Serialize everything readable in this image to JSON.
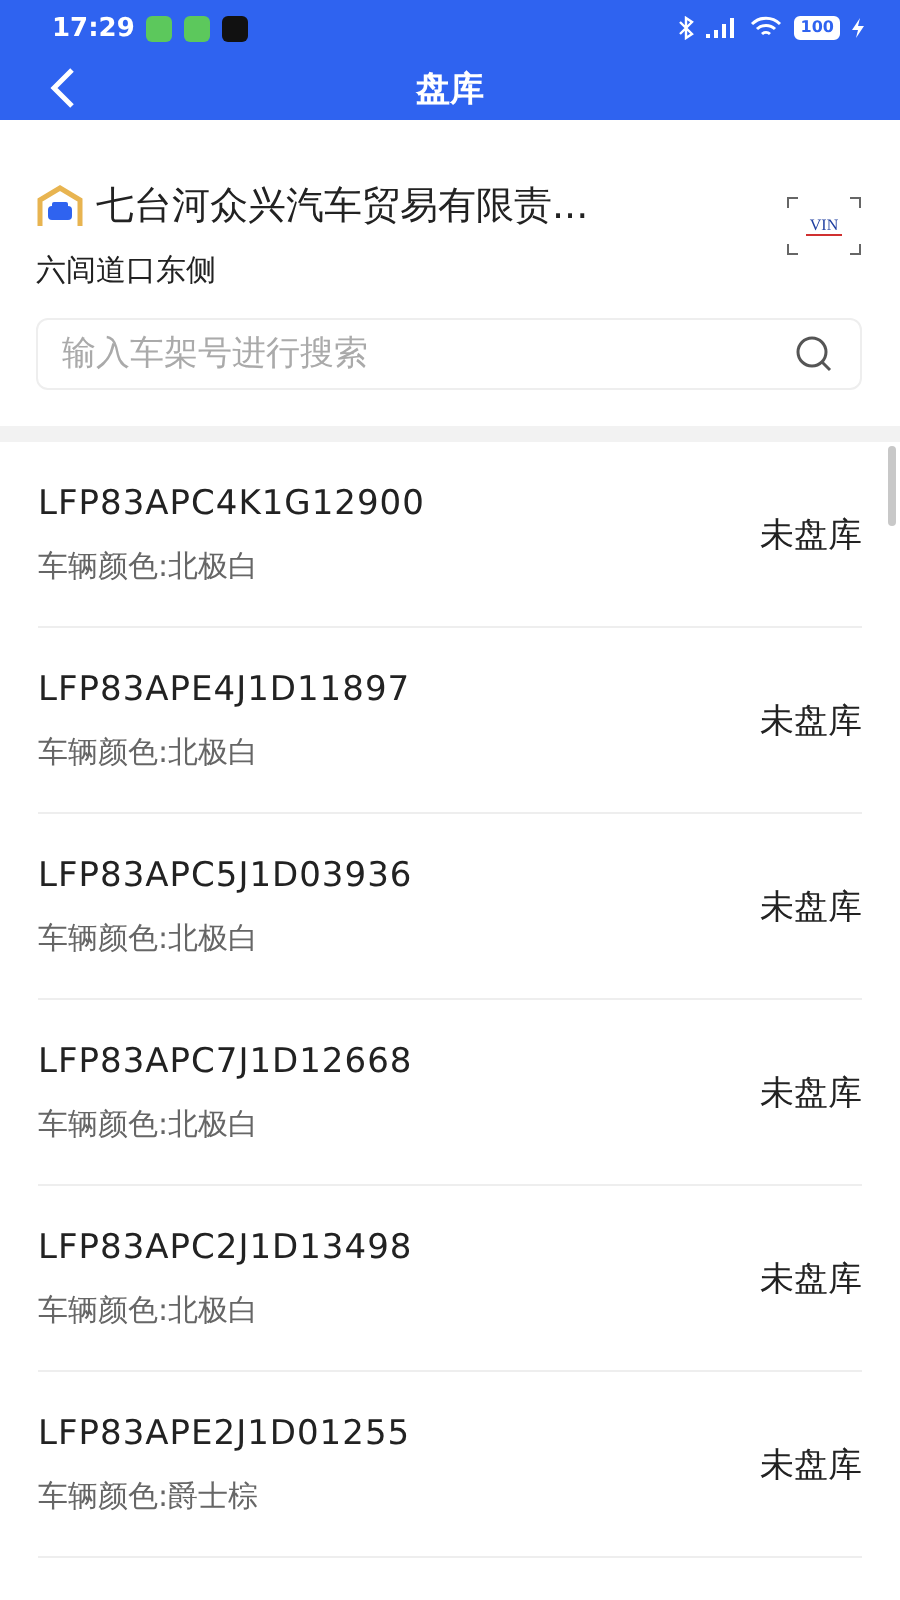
{
  "status_bar": {
    "time": "17:29",
    "battery": "100"
  },
  "header": {
    "title": "盘库"
  },
  "store": {
    "name": "七台河众兴汽车贸易有限责...",
    "location": "六闾道口东侧",
    "vin_label": "VIN"
  },
  "search": {
    "placeholder": "输入车架号进行搜索"
  },
  "vehicles": [
    {
      "vin": "LFP83APC4K1G12900",
      "paint": "车辆颜色:北极白",
      "status": "未盘库"
    },
    {
      "vin": "LFP83APE4J1D11897",
      "paint": "车辆颜色:北极白",
      "status": "未盘库"
    },
    {
      "vin": "LFP83APC5J1D03936",
      "paint": "车辆颜色:北极白",
      "status": "未盘库"
    },
    {
      "vin": "LFP83APC7J1D12668",
      "paint": "车辆颜色:北极白",
      "status": "未盘库"
    },
    {
      "vin": "LFP83APC2J1D13498",
      "paint": "车辆颜色:北极白",
      "status": "未盘库"
    },
    {
      "vin": "LFP83APE2J1D01255",
      "paint": "车辆颜色:爵士棕",
      "status": "未盘库"
    }
  ]
}
